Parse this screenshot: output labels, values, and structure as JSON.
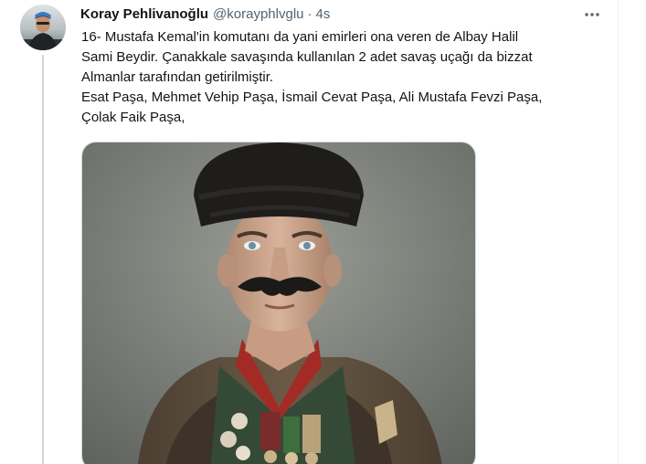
{
  "tweet": {
    "author_name": "Koray Pehlivanoğlu",
    "author_handle": "@korayphlvglu",
    "separator": "·",
    "time": "4s",
    "text_lines": [
      "16- Mustafa Kemal'in komutanı da yani emirleri ona veren de Albay Halil",
      "Sami Beydir. Çanakkale savaşında kullanılan 2 adet savaş uçağı da bizzat",
      "Almanlar tarafından getirilmiştir.",
      "Esat Paşa, Mehmet Vehip Paşa, İsmail Cevat Paşa, Ali Mustafa Fevzi Paşa,",
      "Çolak Faik Paşa,"
    ]
  },
  "icons": {
    "more": "more-horizontal-icon"
  },
  "colors": {
    "text_primary": "#0f1419",
    "text_secondary": "#536471",
    "thread_line": "#cfd9de",
    "photo_background": "#7c8079"
  }
}
